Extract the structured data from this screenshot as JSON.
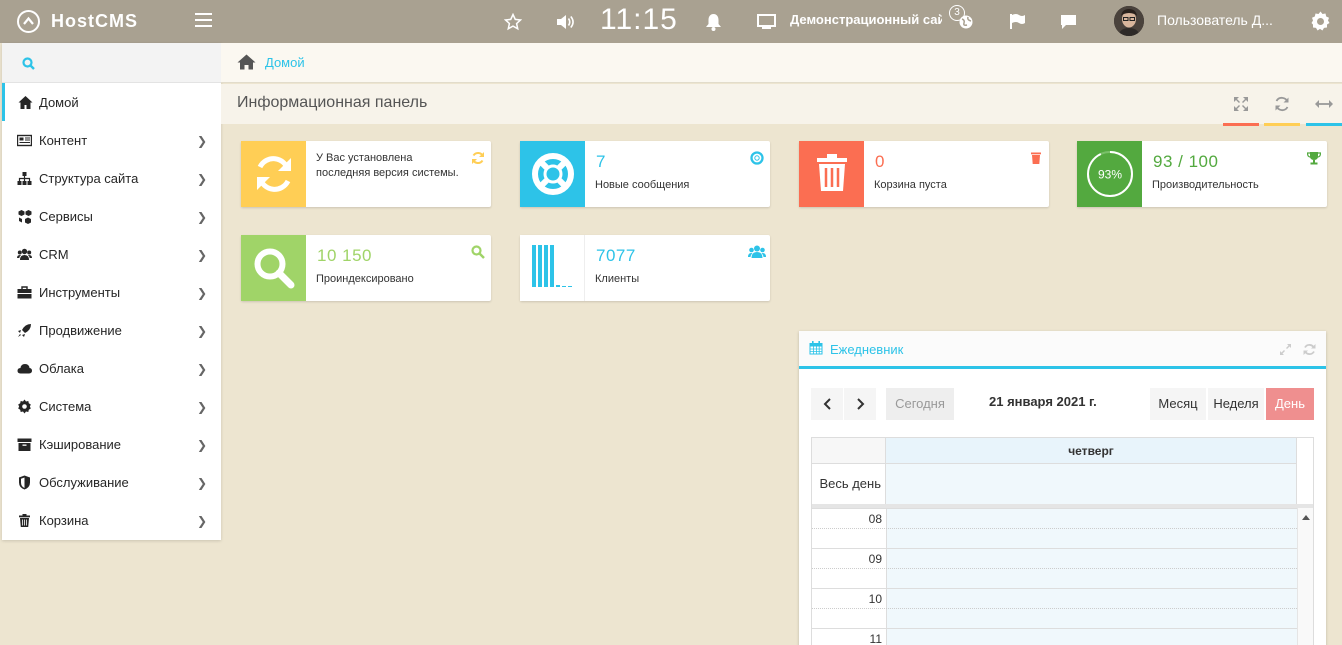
{
  "topbar": {
    "logo": "HostCMS",
    "time": "11:15",
    "site": "Демонстрационный сайт",
    "site_badge": "3",
    "user": "Пользователь Д..."
  },
  "sidebar": {
    "items": [
      {
        "label": "Домой",
        "icon": "home-icon",
        "active": true
      },
      {
        "label": "Контент",
        "icon": "newspaper-icon"
      },
      {
        "label": "Структура сайта",
        "icon": "sitemap-icon"
      },
      {
        "label": "Сервисы",
        "icon": "cubes-icon"
      },
      {
        "label": "CRM",
        "icon": "users-icon"
      },
      {
        "label": "Инструменты",
        "icon": "briefcase-icon"
      },
      {
        "label": "Продвижение",
        "icon": "rocket-icon"
      },
      {
        "label": "Облака",
        "icon": "cloud-icon"
      },
      {
        "label": "Система",
        "icon": "gear-icon"
      },
      {
        "label": "Кэширование",
        "icon": "archive-icon"
      },
      {
        "label": "Обслуживание",
        "icon": "shield-icon"
      },
      {
        "label": "Корзина",
        "icon": "trash-icon"
      }
    ]
  },
  "breadcrumb": {
    "home": "Домой"
  },
  "page": {
    "title": "Информационная панель"
  },
  "colors": {
    "accent": "#2dc3e8",
    "yellow": "#ffce55",
    "red": "#fb6e52",
    "green": "#53a93f",
    "lightgreen": "#a0d468",
    "topbar": "#a9a191",
    "background": "#ede5d0"
  },
  "cards": {
    "update": {
      "line1": "У Вас установлена",
      "line2": "последняя версия системы."
    },
    "messages": {
      "value": "7",
      "caption": "Новые сообщения"
    },
    "trash": {
      "value": "0",
      "caption": "Корзина пуста"
    },
    "performance": {
      "value": "93 / 100",
      "caption": "Производительность",
      "percent": "93%",
      "fraction": 0.93
    },
    "indexed": {
      "value": "10 150",
      "caption": "Проиндексировано"
    },
    "clients": {
      "value": "7077",
      "caption": "Клиенты"
    }
  },
  "calendar": {
    "title": "Ежедневник",
    "today": "Сегодня",
    "date": "21 января 2021 г.",
    "views": [
      "Месяц",
      "Неделя",
      "День"
    ],
    "active_view": "День",
    "day_name": "четверг",
    "all_day": "Весь день",
    "hours": [
      "08",
      "09",
      "10",
      "11"
    ]
  }
}
